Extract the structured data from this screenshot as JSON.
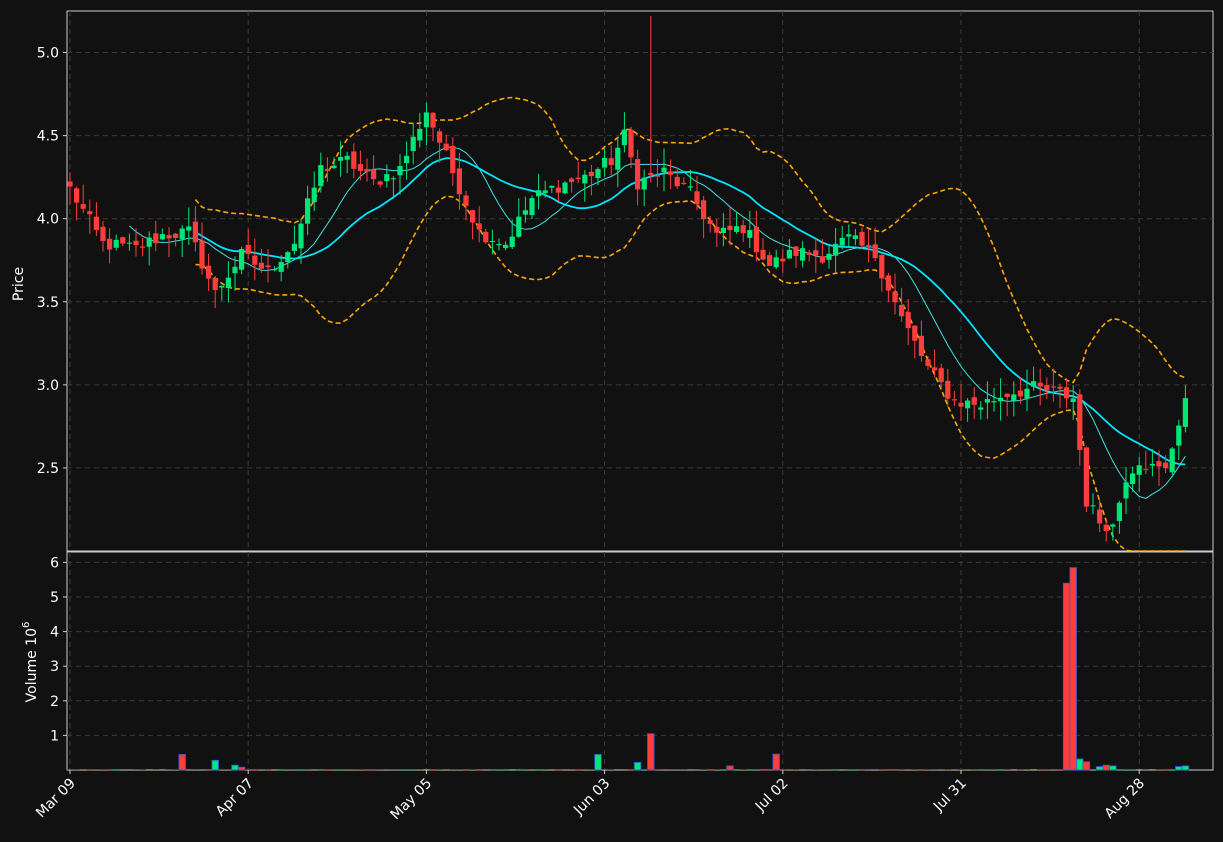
{
  "chart_data": [
    {
      "type": "candlestick",
      "panel": "price",
      "ylabel": "Price",
      "ylim": [
        2.0,
        5.25
      ],
      "yticks": [
        "2.5",
        "3.0",
        "3.5",
        "4.0",
        "4.5",
        "5.0"
      ],
      "xticks": [
        "Mar 09",
        "Apr 07",
        "May 05",
        "Jun 03",
        "Jul 02",
        "Jul 31",
        "Aug 28"
      ],
      "grid": true,
      "colors": {
        "up": "#00e676",
        "down": "#ff3d3d",
        "sma_short": "#40e0e0",
        "sma_long": "#00e5ff",
        "bands": "#ffa500",
        "background": "#111111"
      },
      "anchors": [
        [
          0,
          4.18
        ],
        [
          5,
          3.85
        ],
        [
          10,
          3.82
        ],
        [
          14,
          3.9
        ],
        [
          18,
          3.92
        ],
        [
          22,
          3.55
        ],
        [
          26,
          3.78
        ],
        [
          30,
          3.68
        ],
        [
          34,
          3.86
        ],
        [
          38,
          4.3
        ],
        [
          42,
          4.35
        ],
        [
          46,
          4.22
        ],
        [
          50,
          4.3
        ],
        [
          54,
          4.65
        ],
        [
          58,
          4.28
        ],
        [
          62,
          3.92
        ],
        [
          66,
          3.85
        ],
        [
          70,
          4.12
        ],
        [
          74,
          4.2
        ],
        [
          78,
          4.25
        ],
        [
          82,
          4.35
        ],
        [
          84,
          4.5
        ],
        [
          86,
          4.22
        ],
        [
          90,
          4.28
        ],
        [
          94,
          4.15
        ],
        [
          98,
          3.9
        ],
        [
          102,
          3.95
        ],
        [
          106,
          3.72
        ],
        [
          110,
          3.8
        ],
        [
          114,
          3.78
        ],
        [
          118,
          3.88
        ],
        [
          122,
          3.78
        ],
        [
          126,
          3.4
        ],
        [
          130,
          3.1
        ],
        [
          134,
          2.9
        ],
        [
          138,
          2.88
        ],
        [
          142,
          2.95
        ],
        [
          146,
          2.98
        ],
        [
          150,
          2.95
        ],
        [
          152,
          2.92
        ],
        [
          154,
          2.3
        ],
        [
          156,
          2.18
        ],
        [
          158,
          2.15
        ],
        [
          160,
          2.45
        ],
        [
          162,
          2.55
        ],
        [
          164,
          2.5
        ],
        [
          166,
          2.48
        ],
        [
          168,
          2.78
        ],
        [
          169,
          2.92
        ]
      ],
      "series": [
        {
          "kind": "sma_short_period",
          "window": 10
        },
        {
          "kind": "sma_long_period",
          "window": 20
        },
        {
          "kind": "bollinger_bands",
          "window": 20,
          "k": 2
        }
      ]
    },
    {
      "type": "bar",
      "panel": "volume",
      "ylabel": "Volume  10^6",
      "ylabel_main": "Volume",
      "ylabel_exp": "6",
      "ylim": [
        0,
        6.3
      ],
      "yticks": [
        "1",
        "2",
        "3",
        "4",
        "5",
        "6"
      ],
      "spikes": [
        {
          "index": 17,
          "value": 0.45,
          "dir": "down"
        },
        {
          "index": 22,
          "value": 0.28,
          "dir": "up"
        },
        {
          "index": 25,
          "value": 0.14,
          "dir": "up"
        },
        {
          "index": 26,
          "value": 0.08,
          "dir": "down"
        },
        {
          "index": 80,
          "value": 0.45,
          "dir": "up"
        },
        {
          "index": 86,
          "value": 0.22,
          "dir": "up"
        },
        {
          "index": 88,
          "value": 1.05,
          "dir": "down"
        },
        {
          "index": 100,
          "value": 0.12,
          "dir": "down"
        },
        {
          "index": 107,
          "value": 0.46,
          "dir": "down"
        },
        {
          "index": 151,
          "value": 5.4,
          "dir": "down"
        },
        {
          "index": 152,
          "value": 5.85,
          "dir": "down"
        },
        {
          "index": 153,
          "value": 0.32,
          "dir": "up"
        },
        {
          "index": 154,
          "value": 0.24,
          "dir": "down"
        },
        {
          "index": 156,
          "value": 0.1,
          "dir": "up"
        },
        {
          "index": 157,
          "value": 0.14,
          "dir": "down"
        },
        {
          "index": 158,
          "value": 0.12,
          "dir": "up"
        },
        {
          "index": 168,
          "value": 0.1,
          "dir": "up"
        },
        {
          "index": 169,
          "value": 0.12,
          "dir": "up"
        }
      ]
    }
  ]
}
